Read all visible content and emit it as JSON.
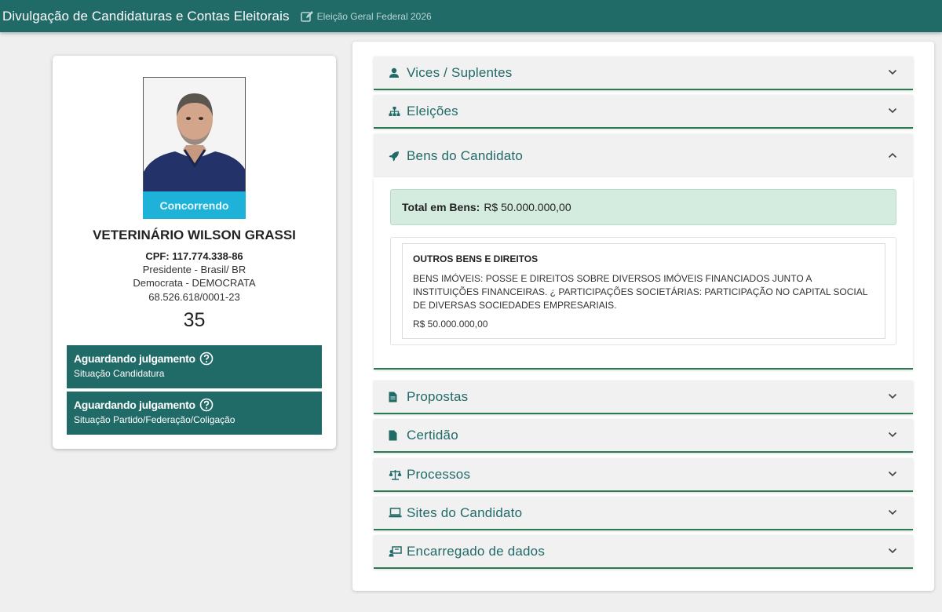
{
  "header": {
    "title": "Divulgação de Candidaturas e Contas Eleitorais",
    "election": "Eleição Geral Federal 2026",
    "election_icon": "edit-icon",
    "bg_color": "#206a68"
  },
  "candidate": {
    "photo_badge": "Concorrendo",
    "name": "VETERINÁRIO WILSON GRASSI",
    "cpf": "CPF: 117.774.338-86",
    "role": "Presidente - Brasil/ BR",
    "party": "Democrata - DEMOCRATA",
    "cnpj": "68.526.618/0001-23",
    "number": "35",
    "status": [
      {
        "title": "Aguardando julgamento",
        "subtitle": "Situação Candidatura"
      },
      {
        "title": "Aguardando julgamento",
        "subtitle": "Situação Partido/Federação/Coligação"
      }
    ]
  },
  "sections": {
    "vices": {
      "label": "Vices / Suplentes",
      "icon": "user-icon"
    },
    "eleicoes": {
      "label": "Eleições",
      "icon": "sitemap-icon"
    },
    "bens": {
      "label": "Bens do Candidato",
      "icon": "rocket-icon",
      "total_label": "Total em Bens:",
      "total_value": "R$ 50.000.000,00",
      "items": [
        {
          "type": "OUTROS BENS E DIREITOS",
          "description": "BENS IMÓVEIS: POSSE E DIREITOS SOBRE DIVERSOS IMÓVEIS FINANCIADOS JUNTO A INSTITUIÇÕES FINANCEIRAS. ¿ PARTICIPAÇÕES SOCIETÁRIAS: PARTICIPAÇÃO NO CAPITAL SOCIAL DE DIVERSAS SOCIEDADES EMPRESARIAIS.",
          "value": "R$ 50.000.000,00"
        }
      ]
    },
    "propostas": {
      "label": "Propostas",
      "icon": "file-icon"
    },
    "certidao": {
      "label": "Certidão",
      "icon": "file-icon"
    },
    "processos": {
      "label": "Processos",
      "icon": "scale-icon"
    },
    "sites": {
      "label": "Sites do Candidato",
      "icon": "laptop-icon"
    },
    "encarregado": {
      "label": "Encarregado de dados",
      "icon": "id-card-icon"
    }
  },
  "colors": {
    "primary": "#206a68",
    "badge": "#1eb2d8",
    "total_bg": "#d4ebdf",
    "accent_border": "#2c7a52"
  }
}
